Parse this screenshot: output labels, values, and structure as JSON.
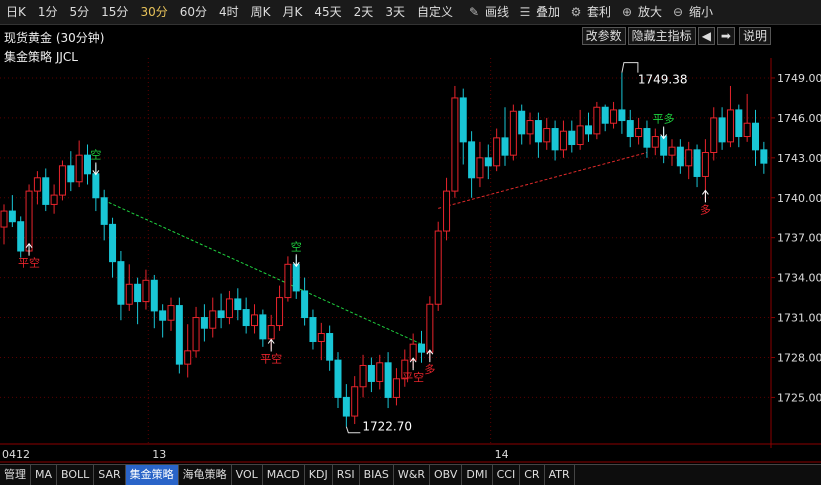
{
  "toolbar": {
    "periods": [
      "日K",
      "1分",
      "5分",
      "15分",
      "30分",
      "60分",
      "4时",
      "周K",
      "月K",
      "45天",
      "2天",
      "3天",
      "自定义"
    ],
    "active_period": "30分",
    "tools": [
      {
        "label": "画线",
        "icon": "pencil-icon"
      },
      {
        "label": "叠加",
        "icon": "stack-icon"
      },
      {
        "label": "套利",
        "icon": "arbitrage-icon"
      },
      {
        "label": "放大",
        "icon": "zoom-in-icon"
      },
      {
        "label": "缩小",
        "icon": "zoom-out-icon"
      }
    ]
  },
  "header": {
    "instrument": "现货黄金 (30分钟)",
    "strategy": "集金策略 JJCL",
    "buttons": {
      "modify_params": "改参数",
      "hide_main": "隐藏主指标",
      "prev": "◀",
      "next": "➡",
      "help": "说明"
    }
  },
  "chart_data": {
    "type": "candlestick",
    "y_ticks": [
      "1725.00",
      "1728.00",
      "1731.00",
      "1734.00",
      "1737.00",
      "1740.00",
      "1743.00",
      "1746.00",
      "1749.00"
    ],
    "ylim": [
      1721.5,
      1750.5
    ],
    "x_labels": [
      {
        "label": "0412",
        "index": 0
      },
      {
        "label": "13",
        "index": 18
      },
      {
        "label": "14",
        "index": 59
      }
    ],
    "high_label": "1749.38",
    "low_label": "1722.70",
    "candles": [
      [
        1737.8,
        1739.0,
        1736.5,
        1739.5
      ],
      [
        1739.0,
        1738.2,
        1737.8,
        1740.2
      ],
      [
        1738.2,
        1736.0,
        1735.5,
        1738.6
      ],
      [
        1736.0,
        1740.5,
        1735.8,
        1741.0
      ],
      [
        1740.5,
        1741.5,
        1739.5,
        1742.0
      ],
      [
        1741.5,
        1739.5,
        1739.0,
        1742.2
      ],
      [
        1739.5,
        1740.2,
        1738.8,
        1741.0
      ],
      [
        1740.2,
        1742.4,
        1739.8,
        1742.8
      ],
      [
        1742.4,
        1741.2,
        1740.5,
        1743.5
      ],
      [
        1741.2,
        1743.2,
        1740.8,
        1744.3
      ],
      [
        1743.2,
        1741.8,
        1741.0,
        1744.0
      ],
      [
        1741.8,
        1740.0,
        1739.0,
        1742.5
      ],
      [
        1740.0,
        1738.0,
        1736.8,
        1740.6
      ],
      [
        1738.0,
        1735.2,
        1734.0,
        1738.5
      ],
      [
        1735.2,
        1732.0,
        1730.8,
        1736.0
      ],
      [
        1732.0,
        1733.5,
        1731.5,
        1735.0
      ],
      [
        1733.5,
        1732.2,
        1730.5,
        1734.0
      ],
      [
        1732.2,
        1733.8,
        1731.6,
        1734.6
      ],
      [
        1733.8,
        1731.5,
        1730.2,
        1734.2
      ],
      [
        1731.5,
        1730.8,
        1729.5,
        1732.0
      ],
      [
        1730.8,
        1731.9,
        1730.0,
        1732.5
      ],
      [
        1731.9,
        1727.5,
        1726.8,
        1732.5
      ],
      [
        1727.5,
        1728.5,
        1726.5,
        1730.5
      ],
      [
        1728.5,
        1731.0,
        1728.0,
        1731.8
      ],
      [
        1731.0,
        1730.2,
        1729.2,
        1732.0
      ],
      [
        1730.2,
        1731.5,
        1729.5,
        1732.5
      ],
      [
        1731.5,
        1731.0,
        1730.2,
        1732.8
      ],
      [
        1731.0,
        1732.4,
        1730.5,
        1733.0
      ],
      [
        1732.4,
        1731.6,
        1730.8,
        1733.2
      ],
      [
        1731.6,
        1730.4,
        1729.8,
        1732.5
      ],
      [
        1730.4,
        1731.2,
        1729.8,
        1732.0
      ],
      [
        1731.2,
        1729.4,
        1728.8,
        1731.6
      ],
      [
        1729.4,
        1730.4,
        1728.6,
        1731.2
      ],
      [
        1730.4,
        1732.5,
        1730.0,
        1733.4
      ],
      [
        1732.5,
        1735.0,
        1732.2,
        1735.6
      ],
      [
        1735.0,
        1733.0,
        1732.4,
        1735.6
      ],
      [
        1733.0,
        1731.0,
        1730.4,
        1734.0
      ],
      [
        1731.0,
        1729.2,
        1728.6,
        1731.6
      ],
      [
        1729.2,
        1729.8,
        1727.8,
        1730.6
      ],
      [
        1729.8,
        1727.8,
        1727.0,
        1730.4
      ],
      [
        1727.8,
        1725.0,
        1724.2,
        1728.4
      ],
      [
        1725.0,
        1723.6,
        1722.8,
        1726.0
      ],
      [
        1723.6,
        1725.8,
        1723.0,
        1726.6
      ],
      [
        1725.8,
        1727.4,
        1725.0,
        1728.2
      ],
      [
        1727.4,
        1726.2,
        1725.4,
        1728.0
      ],
      [
        1726.2,
        1727.6,
        1725.6,
        1728.2
      ],
      [
        1727.6,
        1725.0,
        1724.2,
        1728.4
      ],
      [
        1725.0,
        1726.4,
        1724.4,
        1727.2
      ],
      [
        1726.4,
        1727.8,
        1725.8,
        1728.6
      ],
      [
        1727.8,
        1729.0,
        1727.2,
        1729.8
      ],
      [
        1729.0,
        1728.4,
        1727.6,
        1730.0
      ],
      [
        1728.4,
        1732.0,
        1727.8,
        1732.6
      ],
      [
        1732.0,
        1737.5,
        1731.5,
        1738.2
      ],
      [
        1737.5,
        1740.5,
        1736.8,
        1741.5
      ],
      [
        1740.5,
        1747.5,
        1740.0,
        1748.4
      ],
      [
        1747.5,
        1744.2,
        1742.5,
        1748.2
      ],
      [
        1744.2,
        1741.5,
        1740.0,
        1745.0
      ],
      [
        1741.5,
        1743.0,
        1740.8,
        1744.2
      ],
      [
        1743.0,
        1742.4,
        1741.4,
        1744.0
      ],
      [
        1742.4,
        1744.5,
        1742.0,
        1745.2
      ],
      [
        1744.5,
        1743.2,
        1742.4,
        1746.8
      ],
      [
        1743.2,
        1746.5,
        1742.8,
        1747.0
      ],
      [
        1746.5,
        1744.8,
        1744.0,
        1747.0
      ],
      [
        1744.8,
        1745.8,
        1744.0,
        1746.4
      ],
      [
        1745.8,
        1744.2,
        1743.0,
        1746.4
      ],
      [
        1744.2,
        1745.2,
        1743.6,
        1746.0
      ],
      [
        1745.2,
        1743.6,
        1742.8,
        1745.8
      ],
      [
        1743.6,
        1745.0,
        1743.0,
        1745.8
      ],
      [
        1745.0,
        1744.0,
        1743.4,
        1745.8
      ],
      [
        1744.0,
        1745.4,
        1743.6,
        1746.6
      ],
      [
        1745.4,
        1744.8,
        1744.2,
        1746.4
      ],
      [
        1744.8,
        1746.8,
        1744.4,
        1747.2
      ],
      [
        1746.8,
        1745.6,
        1745.0,
        1747.0
      ],
      [
        1745.6,
        1746.6,
        1745.2,
        1747.2
      ],
      [
        1746.6,
        1745.8,
        1744.8,
        1749.4
      ],
      [
        1745.8,
        1744.6,
        1743.8,
        1746.6
      ],
      [
        1744.6,
        1745.2,
        1744.0,
        1746.0
      ],
      [
        1745.2,
        1743.8,
        1743.0,
        1745.8
      ],
      [
        1743.8,
        1744.6,
        1743.2,
        1745.2
      ],
      [
        1744.6,
        1743.2,
        1742.6,
        1745.2
      ],
      [
        1743.2,
        1743.8,
        1742.4,
        1744.4
      ],
      [
        1743.8,
        1742.4,
        1741.8,
        1744.4
      ],
      [
        1742.4,
        1743.6,
        1741.4,
        1744.2
      ],
      [
        1743.6,
        1741.6,
        1740.8,
        1744.0
      ],
      [
        1741.6,
        1743.4,
        1739.8,
        1744.4
      ],
      [
        1743.4,
        1746.0,
        1742.8,
        1746.8
      ],
      [
        1746.0,
        1744.2,
        1743.6,
        1746.8
      ],
      [
        1744.2,
        1746.6,
        1743.8,
        1748.4
      ],
      [
        1746.6,
        1744.6,
        1743.8,
        1747.0
      ],
      [
        1744.6,
        1745.6,
        1744.2,
        1747.8
      ],
      [
        1745.6,
        1743.6,
        1742.4,
        1746.6
      ],
      [
        1743.6,
        1742.6,
        1741.8,
        1744.2
      ]
    ],
    "signals": [
      {
        "index": 3,
        "type": "buy",
        "label": "平空"
      },
      {
        "index": 11,
        "type": "sell",
        "label": "空"
      },
      {
        "index": 32,
        "type": "buy",
        "label": "平空"
      },
      {
        "index": 35,
        "type": "sell",
        "label": "空"
      },
      {
        "index": 49,
        "type": "buy",
        "label": "平空"
      },
      {
        "index": 51,
        "type": "buy",
        "label": "多"
      },
      {
        "index": 79,
        "type": "sell",
        "label": "平多"
      },
      {
        "index": 84,
        "type": "buy",
        "label": "多"
      }
    ],
    "trendlines": [
      {
        "from": [
          12,
          1739.8
        ],
        "to": [
          50,
          1729.0
        ],
        "color": "#1fd13f"
      },
      {
        "from": [
          52,
          1739.2
        ],
        "to": [
          77,
          1743.4
        ],
        "color": "#e02a2a"
      }
    ]
  },
  "tabs": [
    "管理",
    "MA",
    "BOLL",
    "SAR",
    "集金策略",
    "海龟策略",
    "VOL",
    "MACD",
    "KDJ",
    "RSI",
    "BIAS",
    "W&R",
    "OBV",
    "DMI",
    "CCI",
    "CR",
    "ATR"
  ],
  "active_tab": "集金策略",
  "colors": {
    "up": "#e8242c",
    "down": "#19c6d6",
    "buy_signal": "#e8242c",
    "sell_signal": "#1fd13f",
    "grid": "#5a0000",
    "axis": "#8b0000",
    "active_tab": "#2a64c8"
  }
}
